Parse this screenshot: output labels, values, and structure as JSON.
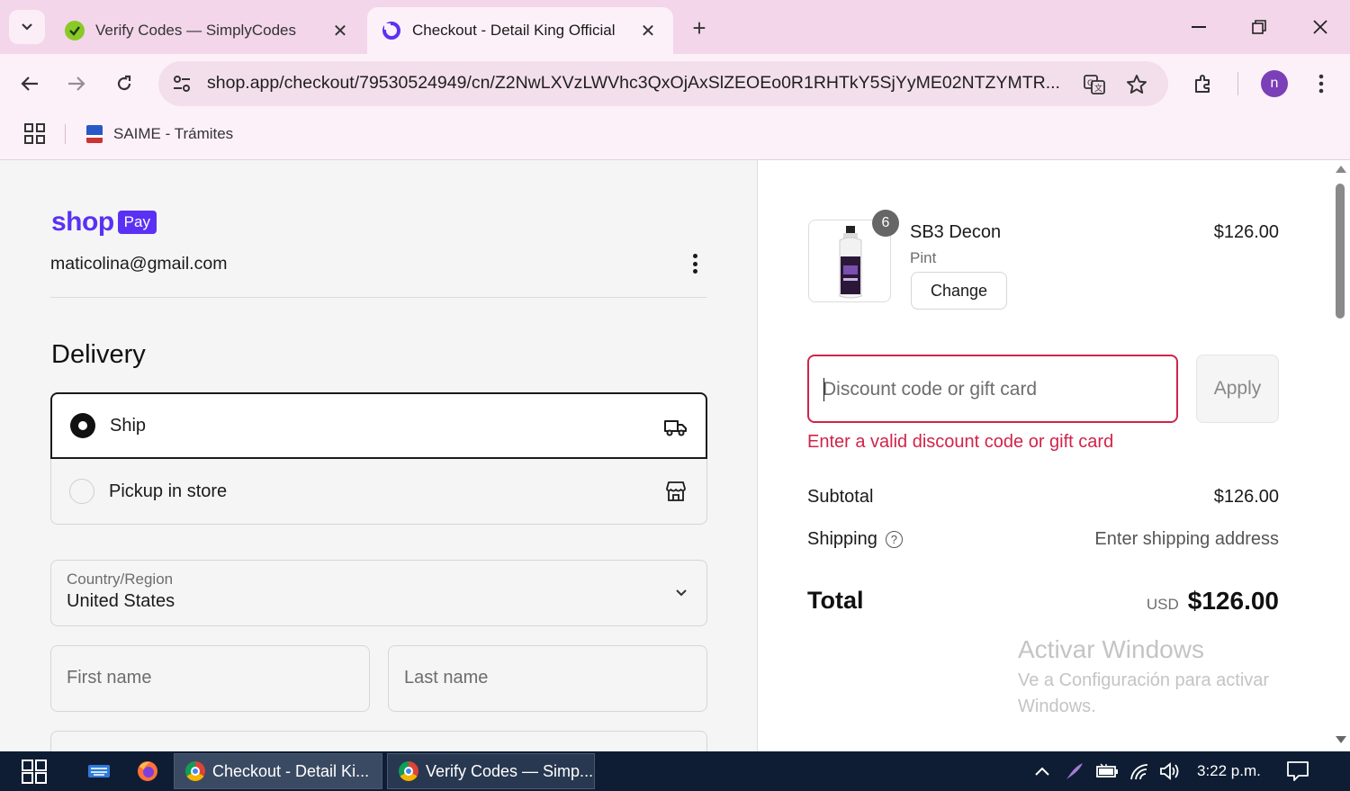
{
  "browser": {
    "tabs": [
      {
        "title": "Verify Codes — SimplyCodes",
        "active": false
      },
      {
        "title": "Checkout - Detail King Official",
        "active": true
      }
    ],
    "url": "shop.app/checkout/79530524949/cn/Z2NwLXVzLWVhc3QxOjAxSlZEOEo0R1RHTkY5SjYyME02NTZYMTR...",
    "bookmarks": [
      {
        "label": "SAIME - Trámites"
      }
    ],
    "profile_initial": "n"
  },
  "checkout": {
    "brand_word": "shop",
    "brand_badge": "Pay",
    "email": "maticolina@gmail.com",
    "delivery_heading": "Delivery",
    "delivery_options": [
      {
        "label": "Ship",
        "selected": true,
        "icon": "truck-icon"
      },
      {
        "label": "Pickup in store",
        "selected": false,
        "icon": "store-icon"
      }
    ],
    "country_label": "Country/Region",
    "country_value": "United States",
    "first_name_placeholder": "First name",
    "last_name_placeholder": "Last name"
  },
  "summary": {
    "item": {
      "name": "SB3 Decon",
      "variant": "Pint",
      "quantity": "6",
      "price": "$126.00",
      "change_label": "Change"
    },
    "discount_placeholder": "Discount code or gift card",
    "discount_value": "",
    "apply_label": "Apply",
    "error": "Enter a valid discount code or gift card",
    "subtotal_label": "Subtotal",
    "subtotal_value": "$126.00",
    "shipping_label": "Shipping",
    "shipping_value": "Enter shipping address",
    "total_label": "Total",
    "total_currency": "USD",
    "total_value": "$126.00",
    "error_color": "#d0244a"
  },
  "watermark": {
    "title": "Activar Windows",
    "subtitle": "Ve a Configuración para activar Windows."
  },
  "taskbar": {
    "apps": [
      {
        "label": "Checkout - Detail Ki...",
        "active": true
      },
      {
        "label": "Verify Codes — Simp...",
        "active": false
      }
    ],
    "time": "3:22 p.m."
  }
}
